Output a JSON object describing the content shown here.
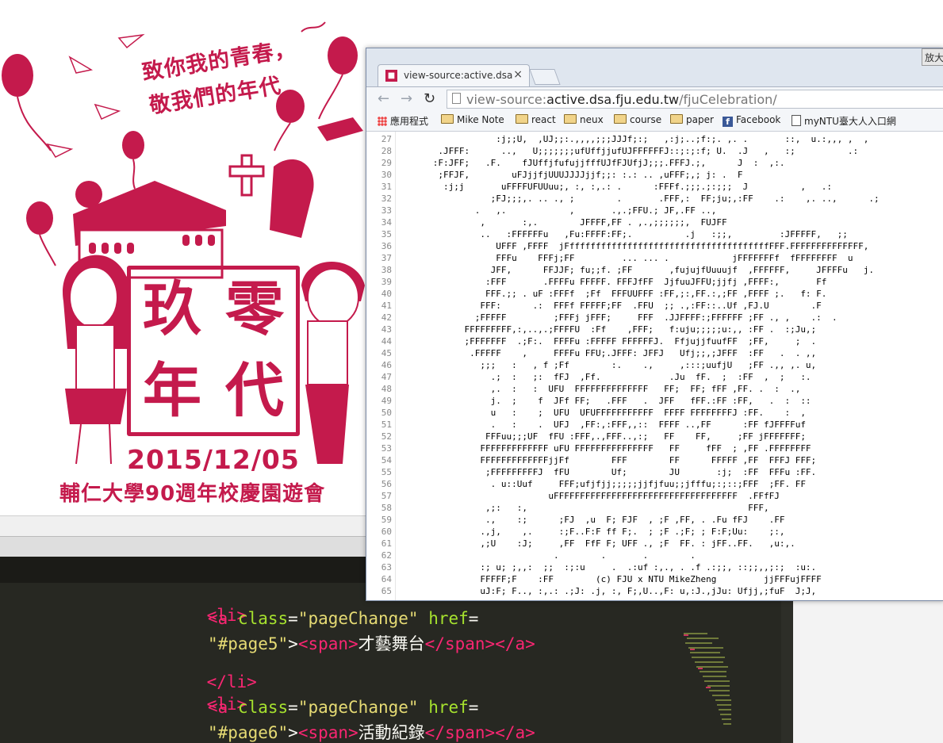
{
  "poster": {
    "headline_1": "致你我的青春，",
    "headline_2": "敬我們的年代",
    "title_chars": [
      "玖",
      "零",
      "年",
      "代"
    ],
    "date": "2015/12/05",
    "caption": "輔仁大學90週年校慶園遊會",
    "accent": "#c41a4c"
  },
  "editor": {
    "lines": [
      {
        "kind": "open_li",
        "text": "<li>"
      },
      {
        "kind": "a_open",
        "tag": "<a",
        "attr": "class",
        "eq": "=",
        "class_val": "\"pageChange\"",
        "href_attr": "href",
        "href_eq": "="
      },
      {
        "kind": "a_body",
        "href_val": "\"#page5\"",
        "lt1": ">",
        "span_open": "<span>",
        "label": "才藝舞台",
        "span_close": "</span>",
        "a_close": "</a>"
      },
      {
        "kind": "close_li",
        "text": "</li>"
      },
      {
        "kind": "open_li",
        "text": "<li>"
      },
      {
        "kind": "a_open",
        "tag": "<a",
        "attr": "class",
        "eq": "=",
        "class_val": "\"pageChange\"",
        "href_attr": "href",
        "href_eq": "="
      },
      {
        "kind": "a_body",
        "href_val": "\"#page6\"",
        "lt1": ">",
        "span_open": "<span>",
        "label": "活動紀錄",
        "span_close": "</span>",
        "a_close": "</a>"
      }
    ]
  },
  "browser": {
    "tab_title": "view-source:active.dsa.fju",
    "tab_close": "×",
    "window_button": "放大",
    "url_scheme": "view-source:",
    "url_host": "active.dsa.fju.edu.tw",
    "url_path": "/fjuCelebration/",
    "bookmarks": [
      {
        "label": "應用程式",
        "icon": "apps-grid-icon"
      },
      {
        "label": "Mike Note",
        "icon": "folder-icon"
      },
      {
        "label": "react",
        "icon": "folder-icon"
      },
      {
        "label": "neux",
        "icon": "folder-icon"
      },
      {
        "label": "course",
        "icon": "folder-icon"
      },
      {
        "label": "paper",
        "icon": "folder-icon"
      },
      {
        "label": "Facebook",
        "icon": "facebook-icon"
      },
      {
        "label": "myNTU臺大人入口網",
        "icon": "page-icon"
      }
    ],
    "source_lines": [
      {
        "n": "27",
        "t": "                  :j;;U,  ,UJ;;:.,,,,;;;JJJf;:;   ,:j;..;f:;. ,. .       ::,  u.:,,, ,  ,"
      },
      {
        "n": "28",
        "t": "       .JFFF:      ..,   U;;;;;;;ufUffjjufUJFFFFFFJ::;:;:f; U.  .J   ,   :;          .:"
      },
      {
        "n": "29",
        "t": "      :F:JFF;   .F.    fJUffjfufujjfffUJfFJUfjJ;;;.FFFJ.;,      J  :  ,:."
      },
      {
        "n": "30",
        "t": "       ;FFJF,        uFJjjfjUUUJJJJjjf;;: :.: .. ,uFFF;,; j: .  F"
      },
      {
        "n": "31",
        "t": "        :j;j       uFFFFUFUUuu;, :, :,.: .      :FFFf.;;;.;:;;;  J          ,   .:"
      },
      {
        "n": "32",
        "t": "                 ;FJ;;;,. .. ., ;        .       .FFF,:  FF;ju;,:FF    .:    ,. ..,      .;"
      },
      {
        "n": "33",
        "t": "              .   ,.            ,       .,.;FFU.; JF,.FF ..,"
      },
      {
        "n": "34",
        "t": "               ,       :,.        JFFFF,FF . ,.,;;;;;;,  FUJFF"
      },
      {
        "n": "35",
        "t": "               ..   :FFFFFFu   ,Fu:FFFF:FF;.          .j   :;;,         :JFFFFF,   ;;"
      },
      {
        "n": "36",
        "t": "                  UFFF ,FFFF  jFffffffffffffffffffffffffffffffffffffffFFF.FFFFFFFFFFFFFF,"
      },
      {
        "n": "37",
        "t": "                  FFFu    FFFj;FF         ... ... .            jFFFFFFFf  fFFFFFFFF  u"
      },
      {
        "n": "38",
        "t": "                 JFF,      FFJJF; fu;;f. ;FF       ,fujujfUuuujf  ,FFFFFF,     JFFFFu   j."
      },
      {
        "n": "39",
        "t": "                :FFF       .FFFFu FFFFF. FFFJfFF  JjfuuJFFU;jjfj ,FFFF:,       Ff"
      },
      {
        "n": "40",
        "t": "                FFF.;; . uF :FFFf  ;Ff  FFFUUFFF :FF,;:,FF.:,;FF ,FFFF ;.   f: F."
      },
      {
        "n": "41",
        "t": "               FFF:      .:  FFFf FFFFF;FF  .FFU  ;; .,:FF::..Uf ,FJ.U        .F"
      },
      {
        "n": "42",
        "t": "              ;FFFFF         ;FFFj jFFF;     FFF  .JJFFFF:;FFFFFF ;FF ., ,    .:  ."
      },
      {
        "n": "43",
        "t": "            FFFFFFFFF,:,..,.;FFFFU  :Ff    ,FFF;   f:uju;;;;;u:,, :FF .  :;Ju,;"
      },
      {
        "n": "44",
        "t": "            ;FFFFFFF  .;F:.  FFFFu :FFFFF FFFFFFJ.  FfjujjfuufFF  ;FF,     ;  ."
      },
      {
        "n": "45",
        "t": "             .FFFFF    ,     FFFFu FFU;.JFFF: JFFJ   Ufj;;,;JFFF  :FF   .  . ,,"
      },
      {
        "n": "46",
        "t": "               ;;;   :   , f ;Ff        :.    .,     ,:::;uufjU   ;FF .,, ,. u,"
      },
      {
        "n": "47",
        "t": "                 .;  :   ;:  fFJ  ,Ff.             .Ju  fF.  ;  :FF  ,  ;   :."
      },
      {
        "n": "48",
        "t": "                 ,.  :   :  UFU  FFFFFFFFFFFFFF   FF;  FF; fFF ,FF. .  :  .,"
      },
      {
        "n": "49",
        "t": "                 j.  ;    f  JFf FF;   .FFF   .  JFF   fFF.:FF :FF,   .  :  ::"
      },
      {
        "n": "50",
        "t": "                 u   :    ;  UFU  UFUFFFFFFFFFFF  FFFF FFFFFFFFJ :FF.    :  ,"
      },
      {
        "n": "51",
        "t": "                 .   :    .  UFJ  ,FF:,:FFF,,::  FFFF ..,FF      :FF fJFFFFuf"
      },
      {
        "n": "52",
        "t": "                FFFuu;;;UF  fFU :FFF,.,FFF..,:;   FF    FF,     ;FF jFFFFFFF;"
      },
      {
        "n": "53",
        "t": "               FFFFFFFFFFFFF uFU FFFFFFFFFFFFFFF   FF     fFF  ; ,FF .FFFFFFFF"
      },
      {
        "n": "54",
        "t": "               FFFFFFFFFFFFFjjFf        FFF        FF      FFFFF ,FF  FFFJ FFF;"
      },
      {
        "n": "55",
        "t": "                ;FFFFFFFFFJ  fFU        Uf;        JU       :j;  :FF  FFFu :FF."
      },
      {
        "n": "56",
        "t": "                 . u::Uuf     FFF;ufjfjj;;;;;jjfjfuu;;jfffu;:;::;FFF  ;FF. FF"
      },
      {
        "n": "57",
        "t": "                            uFFFFFFFFFFFFFFFFFFFFFFFFFFFFFFFFFFF  .FFfFJ"
      },
      {
        "n": "58",
        "t": "                ,;:   :,                                          FFF,"
      },
      {
        "n": "59",
        "t": "                .,    :;      ;FJ  ,u  F; FJF  , ;F ,FF, . .Fu fFJ    .FF"
      },
      {
        "n": "60",
        "t": "               .,j,    ,.     :;F..F:F ff F;.  ; ;F .;F; ; F:F;Uu:    ;:,"
      },
      {
        "n": "61",
        "t": "               ,;U    :J;     ,FF  FfF F; UFF ., ;F  FF. : jFF..FF.   ,u:,."
      },
      {
        "n": "62",
        "t": "                             .        .       .        ."
      },
      {
        "n": "63",
        "t": "               :; u; ;,,:  ;;  :;:u     .  .:uf :,., . .f .:;;, ::;;,,;:;  :u:."
      },
      {
        "n": "64",
        "t": "               FFFFF;F    :FF        (c) FJU x NTU MikeZheng         jjFFFujFFFF"
      },
      {
        "n": "65",
        "t": "               uJ:F; F.., :,.: .;J: .j, :, F;,U..,F: u,:J.,jJu: Ufjj,;fuF  J;J,"
      }
    ]
  }
}
